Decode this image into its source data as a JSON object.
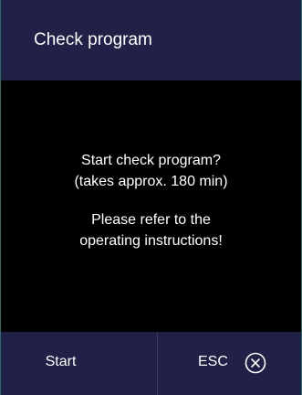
{
  "header": {
    "title": "Check program"
  },
  "message": {
    "question_line1": "Start check program?",
    "question_line2": "(takes approx. 180 min)",
    "refer_line1": "Please refer to the",
    "refer_line2": "operating instructions!"
  },
  "footer": {
    "start_label": "Start",
    "esc_label": "ESC",
    "esc_icon": "close-circle-icon"
  },
  "colors": {
    "panel": "#212147",
    "background": "#000000",
    "text": "#ffffff"
  }
}
